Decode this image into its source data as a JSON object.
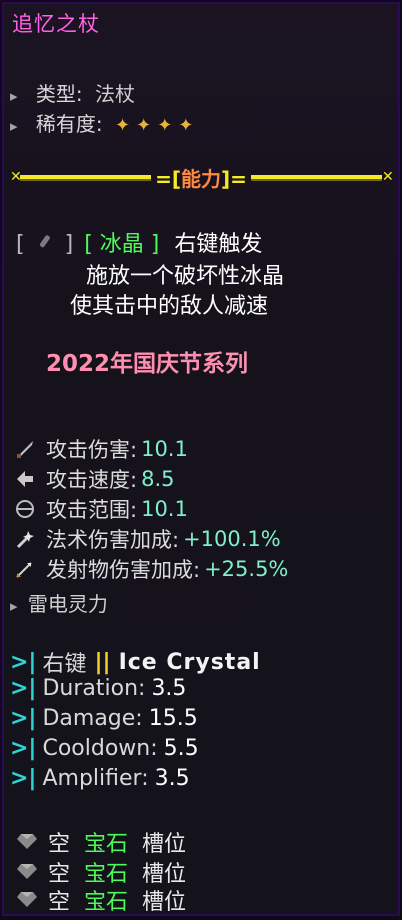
{
  "item": {
    "name": "追忆之杖",
    "type_label": "类型:",
    "type_value": "法杖",
    "rarity_label": "稀有度:",
    "rarity_stars": 4
  },
  "divider": {
    "title": "能力"
  },
  "ability": {
    "key_open": "[",
    "key_close": "]",
    "name": "[ 冰晶 ]",
    "trigger": "右键触发",
    "line2": "施放一个破坏性冰晶",
    "line3": "使其击中的敌人减速"
  },
  "series": "2022年国庆节系列",
  "stats": [
    {
      "label": "攻击伤害:",
      "value": "10.1",
      "icon": "sword-icon"
    },
    {
      "label": "攻击速度:",
      "value": "8.5",
      "icon": "speed-icon"
    },
    {
      "label": "攻击范围:",
      "value": "10.1",
      "icon": "range-icon"
    },
    {
      "label": "法术伤害加成:",
      "value": "+100.1%",
      "icon": "magic-icon"
    },
    {
      "label": "发射物伤害加成:",
      "value": "+25.5%",
      "icon": "projectile-icon"
    }
  ],
  "element": "雷电灵力",
  "spell": {
    "key": "右键",
    "name": "Ice Crystal",
    "props": [
      {
        "label": "Duration:",
        "value": "3.5"
      },
      {
        "label": "Damage:",
        "value": "15.5"
      },
      {
        "label": "Cooldown:",
        "value": "5.5"
      },
      {
        "label": "Amplifier:",
        "value": "3.5"
      }
    ]
  },
  "gems": [
    {
      "empty": "空",
      "gem": "宝石",
      "slot": "槽位"
    },
    {
      "empty": "空",
      "gem": "宝石",
      "slot": "槽位"
    },
    {
      "empty": "空",
      "gem": "宝石",
      "slot": "槽位"
    }
  ],
  "colors": {
    "title": "#ff62e6",
    "divider": "#f4ea25",
    "value": "#7df0cd",
    "green": "#4cfa5a",
    "series": "#ff8fb1"
  }
}
